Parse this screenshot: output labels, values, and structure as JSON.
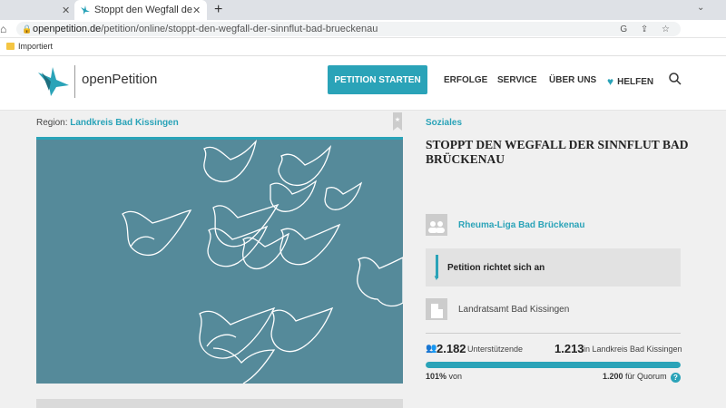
{
  "browser": {
    "inactive_tab_close": "✕",
    "active_tab_title": "Stoppt den Wegfall der Sinnflut Bad Brückenau",
    "active_tab_close": "✕",
    "new_tab": "+",
    "url_domain": "openpetition.de",
    "url_path": "/petition/online/stoppt-den-wegfall-der-sinnflut-bad-brueckenau",
    "bookmark_folder": "Importiert"
  },
  "header": {
    "logo_text": "openPetition",
    "start_button": "PETITION STARTEN",
    "nav": [
      "ERFOLGE",
      "SERVICE",
      "ÜBER UNS",
      "HELFEN"
    ]
  },
  "petition": {
    "region_label": "Region:",
    "region_value": "Landkreis Bad Kissingen",
    "category": "Soziales",
    "title": "STOPPT DEN WEGFALL DER SINNFLUT BAD BRÜCKENAU",
    "author": "Rheuma-Liga Bad Brückenau",
    "addressed_to": "Petition richtet sich an",
    "recipient": "Landratsamt Bad Kissingen",
    "supporters": "2.182",
    "supporters_label": "Unterstützende",
    "regional": "1.213",
    "regional_label": "in Landkreis Bad Kissingen",
    "percent": "101%",
    "percent_label": "von",
    "quorum": "1.200",
    "quorum_label": "für Quorum",
    "progress_fraction": 1.0
  },
  "colors": {
    "accent": "#2aa3b8",
    "hero_bg": "#558a9a"
  }
}
